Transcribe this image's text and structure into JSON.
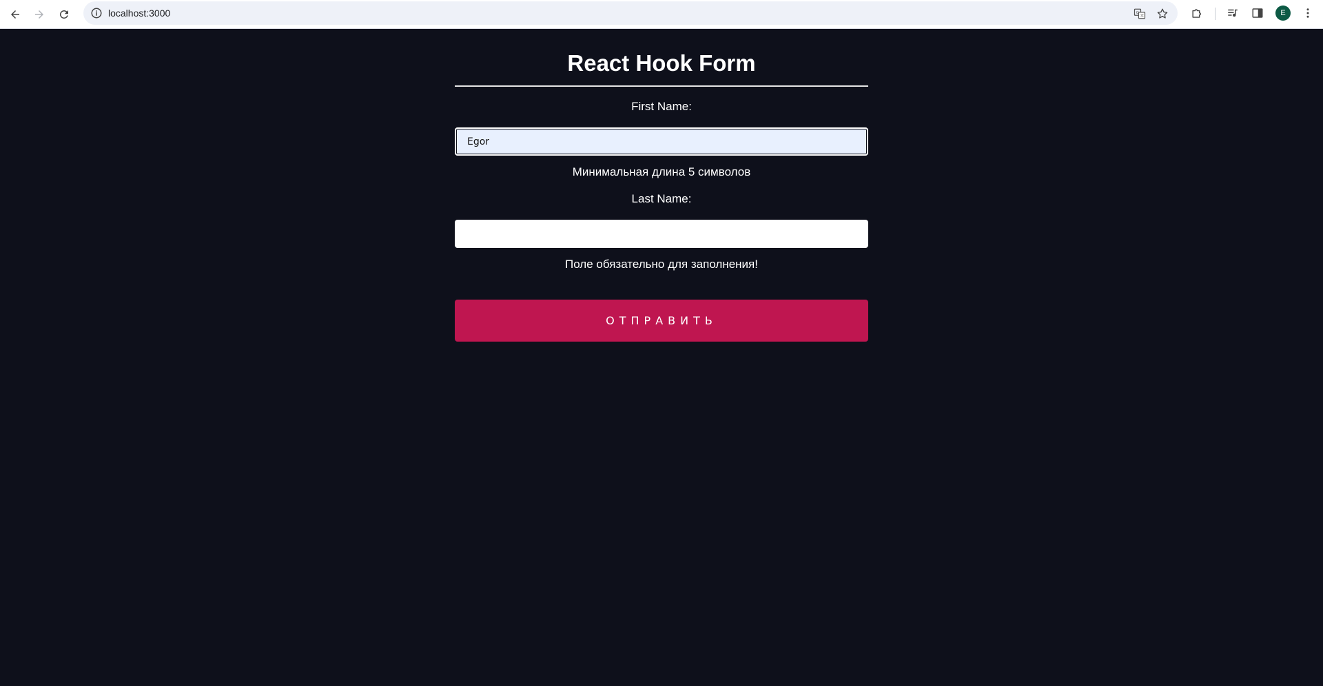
{
  "browser": {
    "url": "localhost:3000",
    "avatar_initial": "E",
    "icons": {
      "back": "arrow-left-icon",
      "forward": "arrow-right-icon",
      "reload": "reload-icon",
      "site_info": "info-icon",
      "translate": "translate-icon",
      "bookmark": "star-icon",
      "extensions": "puzzle-icon",
      "media": "media-controls-icon",
      "side_panel": "side-panel-icon",
      "menu": "kebab-menu-icon"
    }
  },
  "form": {
    "title": "React Hook Form",
    "first_name": {
      "label": "First Name:",
      "value": "Egor",
      "error": "Минимальная длина 5 символов"
    },
    "last_name": {
      "label": "Last Name:",
      "value": "",
      "error": "Поле обязательно для заполнения!"
    },
    "submit_label": "ОТПРАВИТЬ"
  },
  "colors": {
    "page_background": "#0e101b",
    "button_accent": "#bf1650",
    "autofill_background": "#e8f0fe",
    "avatar": "#0d5a45"
  }
}
